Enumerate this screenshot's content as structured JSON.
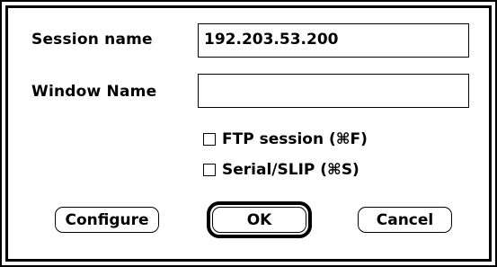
{
  "dialog": {
    "session_name_label": "Session name",
    "session_name_value": "192.203.53.200",
    "window_name_label": "Window Name",
    "window_name_value": "",
    "ftp_session_label": "FTP session (⌘F)",
    "ftp_session_checked": false,
    "serial_slip_label": "Serial/SLIP (⌘S)",
    "serial_slip_checked": false,
    "configure_button": "Configure",
    "ok_button": "OK",
    "cancel_button": "Cancel"
  }
}
